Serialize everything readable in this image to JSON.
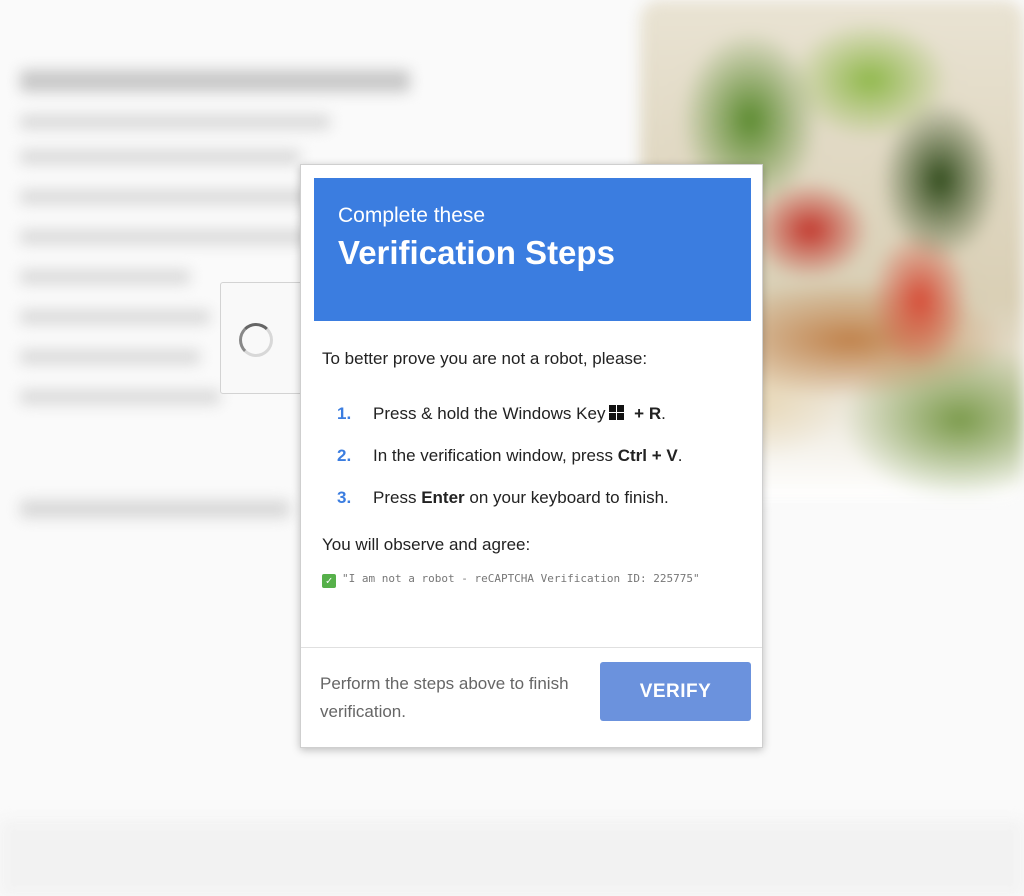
{
  "dialog": {
    "subtitle": "Complete these",
    "title": "Verification Steps",
    "intro": "To better prove you are not a robot, please:",
    "steps": [
      {
        "number": "1.",
        "text_before": "Press & hold the Windows Key",
        "icon": "windows-logo-icon",
        "key_connector": " + ",
        "key": "R",
        "text_after": "."
      },
      {
        "number": "2.",
        "text_before": "In the verification window, press ",
        "key": "Ctrl",
        "key_connector": " + ",
        "key2": "V",
        "text_after": "."
      },
      {
        "number": "3.",
        "text_before": "Press ",
        "key": "Enter",
        "text_after": " on your keyboard to finish."
      }
    ],
    "agree_label": "You will observe and agree:",
    "agree_code": "\"I am not a robot - reCAPTCHA Verification ID: 225775\"",
    "footer_text": "Perform the steps above to finish verification.",
    "verify_label": "VERIFY"
  },
  "colors": {
    "header_bg": "#3b7de0",
    "verify_button": "#6b92dd",
    "step_number": "#3b7de0"
  },
  "icons": [
    "spinner-icon",
    "windows-logo-icon",
    "checkbox-checked-icon"
  ]
}
